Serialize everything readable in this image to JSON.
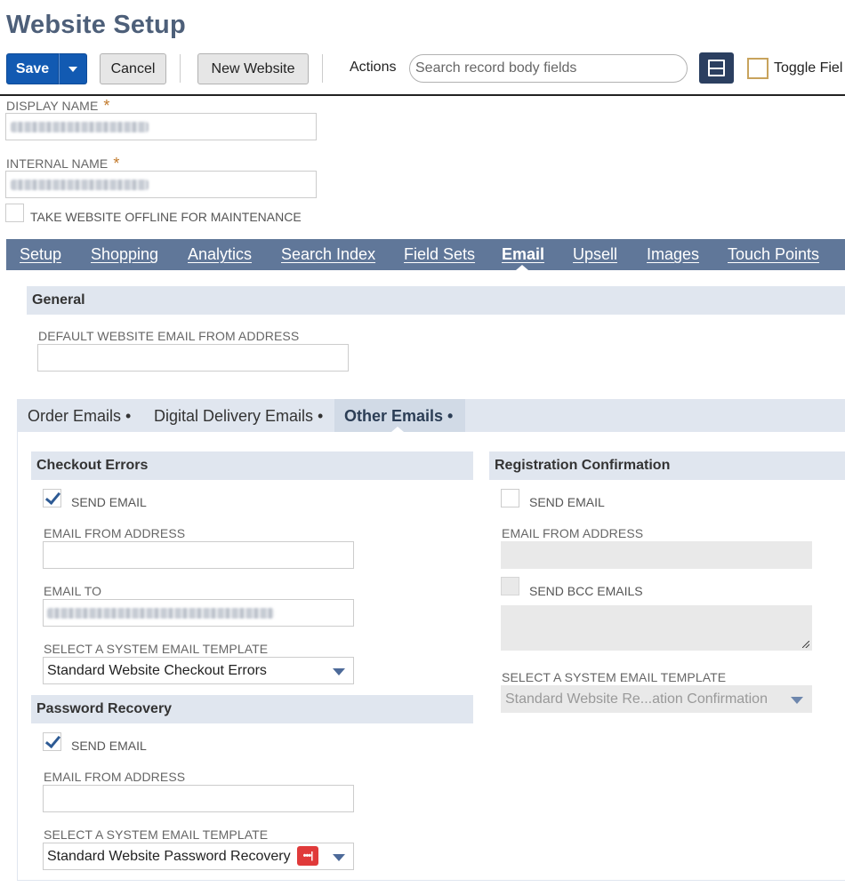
{
  "header": {
    "title": "Website Setup",
    "save_label": "Save",
    "cancel_label": "Cancel",
    "new_website_label": "New Website",
    "actions_label": "Actions",
    "search_placeholder": "Search record body fields",
    "toggle_label": "Toggle Fiel"
  },
  "fields": {
    "display_name_label": "DISPLAY NAME",
    "internal_name_label": "INTERNAL NAME",
    "required_mark": "*",
    "offline_label": "TAKE WEBSITE OFFLINE FOR MAINTENANCE"
  },
  "tabs": [
    {
      "label": "Setup"
    },
    {
      "label": "Shopping"
    },
    {
      "label": "Analytics"
    },
    {
      "label": "Search Index"
    },
    {
      "label": "Field Sets"
    },
    {
      "label": "Email"
    },
    {
      "label": "Upsell"
    },
    {
      "label": "Images"
    },
    {
      "label": "Touch Points"
    }
  ],
  "general": {
    "title": "General",
    "default_from_label": "DEFAULT WEBSITE EMAIL FROM ADDRESS"
  },
  "subtabs": [
    {
      "label": "Order Emails •"
    },
    {
      "label": "Digital Delivery Emails •"
    },
    {
      "label": "Other Emails •"
    }
  ],
  "checkout_errors": {
    "title": "Checkout Errors",
    "send_email_label": "SEND EMAIL",
    "from_label": "EMAIL FROM ADDRESS",
    "to_label": "EMAIL TO",
    "template_label": "SELECT A SYSTEM EMAIL TEMPLATE",
    "template_value": "Standard Website Checkout Errors"
  },
  "password_recovery": {
    "title": "Password Recovery",
    "send_email_label": "SEND EMAIL",
    "from_label": "EMAIL FROM ADDRESS",
    "template_label": "SELECT A SYSTEM EMAIL TEMPLATE",
    "template_value": "Standard Website Password Recovery",
    "badge": "•••|"
  },
  "registration_confirmation": {
    "title": "Registration Confirmation",
    "send_email_label": "SEND EMAIL",
    "from_label": "EMAIL FROM ADDRESS",
    "bcc_label": "SEND BCC EMAILS",
    "template_label": "SELECT A SYSTEM EMAIL TEMPLATE",
    "template_value": "Standard Website Re...ation Confirmation"
  },
  "colors": {
    "title": "#4d5f79",
    "primary_button": "#125ab2",
    "tab_bar": "#607799",
    "section_header": "#e0e6ef",
    "required": "#c27a2c"
  }
}
